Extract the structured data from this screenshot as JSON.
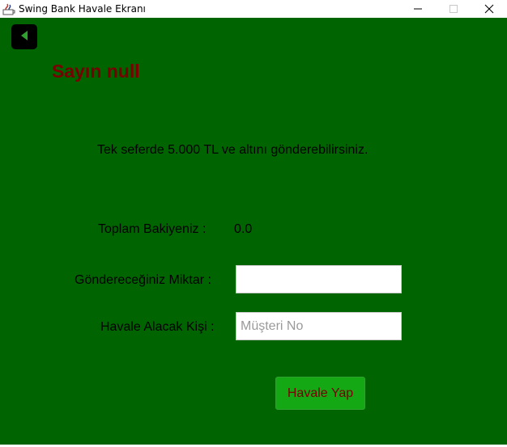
{
  "window": {
    "title": "Swing Bank Havale Ekranı",
    "app_icon": "java-app-icon",
    "controls": {
      "minimize_icon": "minimize-icon",
      "maximize_icon": "maximize-icon",
      "close_icon": "close-icon"
    }
  },
  "colors": {
    "background": "#006400",
    "greeting": "#7a0000",
    "button_bg": "#15a815",
    "button_text": "#7a0000",
    "back_button_bg": "#000000",
    "back_arrow": "#2ea12e"
  },
  "header": {
    "back_icon": "back-arrow-icon",
    "greeting": "Sayın null"
  },
  "main": {
    "info_text": "Tek seferde 5.000 TL ve altını gönderebilirsiniz.",
    "balance_label": "Toplam Bakiyeniz  :",
    "balance_value": "0.0",
    "amount_label": "Göndereceğiniz Miktar :",
    "amount_value": "",
    "recipient_label": "Havale Alacak Kişi :",
    "recipient_value": "",
    "recipient_placeholder": "Müşteri No",
    "submit_label": "Havale Yap"
  }
}
